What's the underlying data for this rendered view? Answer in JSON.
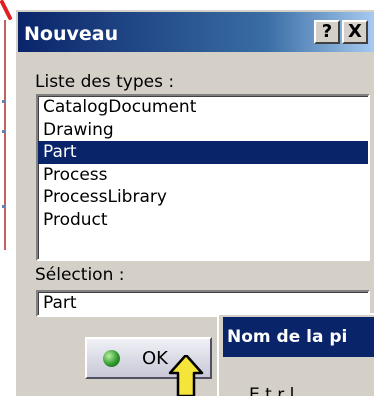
{
  "dialog": {
    "title": "Nouveau",
    "help_button": "?",
    "close_button": "X",
    "list_label": "Liste des types :",
    "types": [
      {
        "label": "CatalogDocument",
        "selected": false
      },
      {
        "label": "Drawing",
        "selected": false
      },
      {
        "label": "Part",
        "selected": true
      },
      {
        "label": "Process",
        "selected": false
      },
      {
        "label": "ProcessLibrary",
        "selected": false
      },
      {
        "label": "Product",
        "selected": false
      }
    ],
    "selection_label": "Sélection :",
    "selection_value": "Part",
    "ok_button": "OK"
  },
  "second_window": {
    "title": "Nom de la pi",
    "body_text": "E t r l"
  },
  "colors": {
    "title_bar": "#0a246a",
    "selection_highlight": "#0a246a",
    "dialog_face": "#d4d0c8",
    "arrow_fill": "#f5e43a",
    "annotation_red": "#e02020"
  },
  "icons": {
    "ok_led": "green-led-icon",
    "pointer_arrow": "yellow-arrow-icon"
  }
}
